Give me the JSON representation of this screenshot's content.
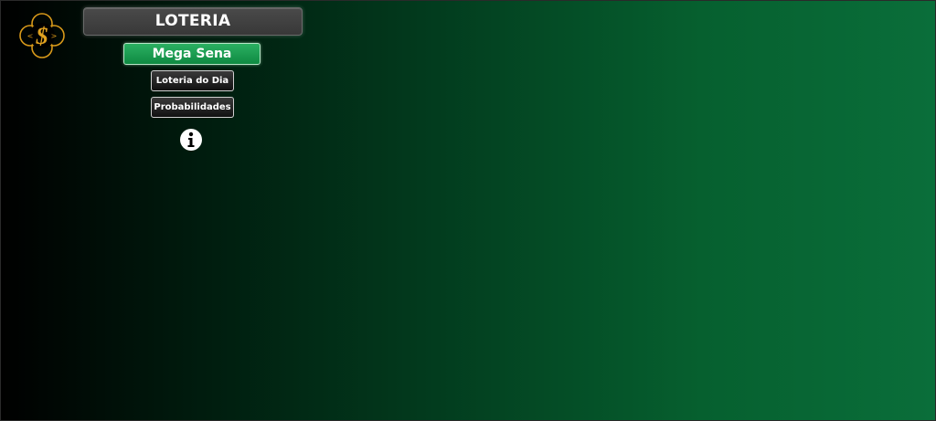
{
  "header": {
    "title": "LOTERIA",
    "logo_icon": "clover-dollar-icon",
    "logo_color": "#d99a1a"
  },
  "menu": {
    "primary_button": "Mega Sena",
    "buttons": [
      "Loteria do Dia",
      "Probabilidades"
    ],
    "info_icon": "info-icon"
  },
  "colors": {
    "background_start": "#000000",
    "background_end": "#0a6e3a",
    "primary_button": "#1a9a50",
    "title_box": "#404040"
  }
}
